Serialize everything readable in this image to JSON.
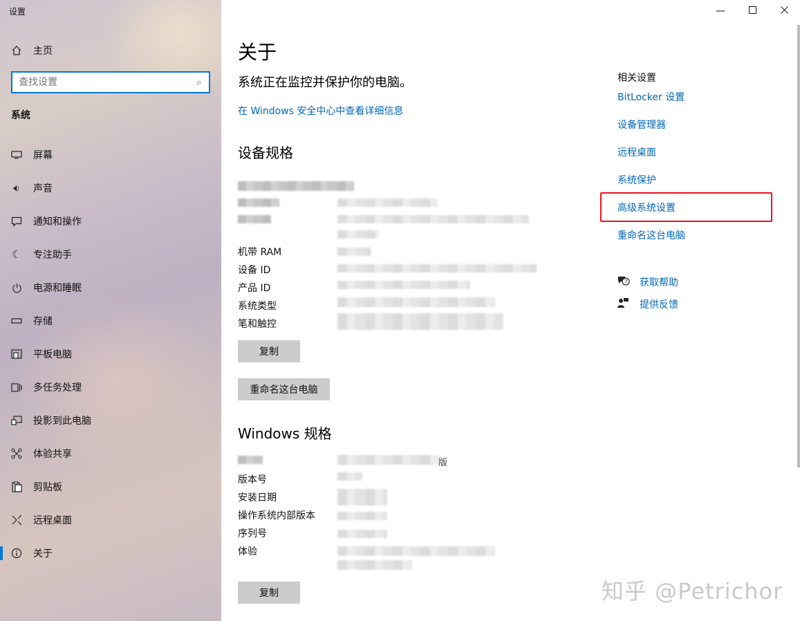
{
  "window": {
    "title": "设置"
  },
  "sidebar": {
    "home_label": "主页",
    "search_placeholder": "查找设置",
    "section_header": "系统",
    "items": [
      {
        "label": "屏幕",
        "icon": "monitor-icon"
      },
      {
        "label": "声音",
        "icon": "sound-icon"
      },
      {
        "label": "通知和操作",
        "icon": "notification-icon"
      },
      {
        "label": "专注助手",
        "icon": "moon-icon"
      },
      {
        "label": "电源和睡眠",
        "icon": "power-icon"
      },
      {
        "label": "存储",
        "icon": "storage-icon"
      },
      {
        "label": "平板电脑",
        "icon": "tablet-icon"
      },
      {
        "label": "多任务处理",
        "icon": "multitask-icon"
      },
      {
        "label": "投影到此电脑",
        "icon": "project-icon"
      },
      {
        "label": "体验共享",
        "icon": "share-icon"
      },
      {
        "label": "剪贴板",
        "icon": "clipboard-icon"
      },
      {
        "label": "远程桌面",
        "icon": "remote-icon"
      },
      {
        "label": "关于",
        "icon": "info-icon"
      }
    ],
    "active_item": "关于"
  },
  "main": {
    "title": "关于",
    "protection_text": "系统正在监控并保护你的电脑。",
    "security_link": "在 Windows 安全中心中查看详细信息",
    "device_specs": {
      "heading": "设备规格",
      "labels": {
        "ram": "机带 RAM",
        "device_id": "设备 ID",
        "product_id": "产品 ID",
        "system_type": "系统类型",
        "pen_touch": "笔和触控"
      },
      "copy_button": "复制",
      "rename_button": "重命名这台电脑"
    },
    "windows_specs": {
      "heading": "Windows 规格",
      "edition_suffix": "版",
      "labels": {
        "version": "版本号",
        "install_date": "安装日期",
        "os_build": "操作系统内部版本",
        "serial": "序列号",
        "experience": "体验"
      },
      "copy_button": "复制"
    }
  },
  "related": {
    "title": "相关设置",
    "links": [
      "BitLocker 设置",
      "设备管理器",
      "远程桌面",
      "系统保护",
      "高级系统设置",
      "重命名这台电脑"
    ],
    "highlighted": "高级系统设置",
    "help_links": [
      {
        "label": "获取帮助",
        "icon": "help-chat-icon"
      },
      {
        "label": "提供反馈",
        "icon": "feedback-icon"
      }
    ]
  },
  "watermark": "知乎 @Petrichor",
  "accent_color": "#0078d7",
  "link_color": "#0067b8",
  "highlight_color": "#e81123"
}
